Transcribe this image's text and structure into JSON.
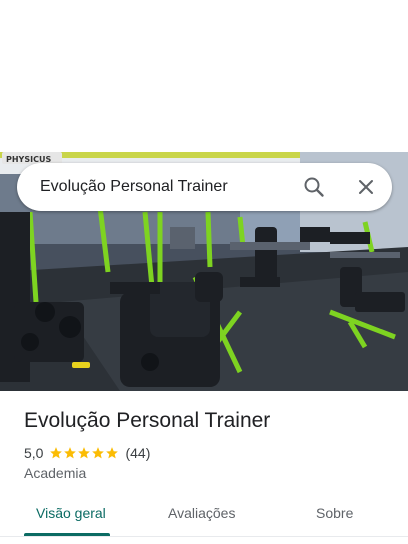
{
  "search": {
    "query": "Evolução Personal Trainer",
    "search_icon": "search-icon",
    "close_icon": "close-icon"
  },
  "hero": {
    "banner_text": "PHYSICUS"
  },
  "place": {
    "name": "Evolução Personal Trainer",
    "rating": "5,0",
    "stars": 5,
    "reviews": "(44)",
    "category": "Academia"
  },
  "tabs": [
    {
      "label": "Visão geral",
      "active": true
    },
    {
      "label": "Avaliações",
      "active": false
    },
    {
      "label": "Sobre",
      "active": false
    }
  ],
  "colors": {
    "accent": "#0b6b63",
    "star": "#fbbc04",
    "machine_green": "#7ed321"
  }
}
